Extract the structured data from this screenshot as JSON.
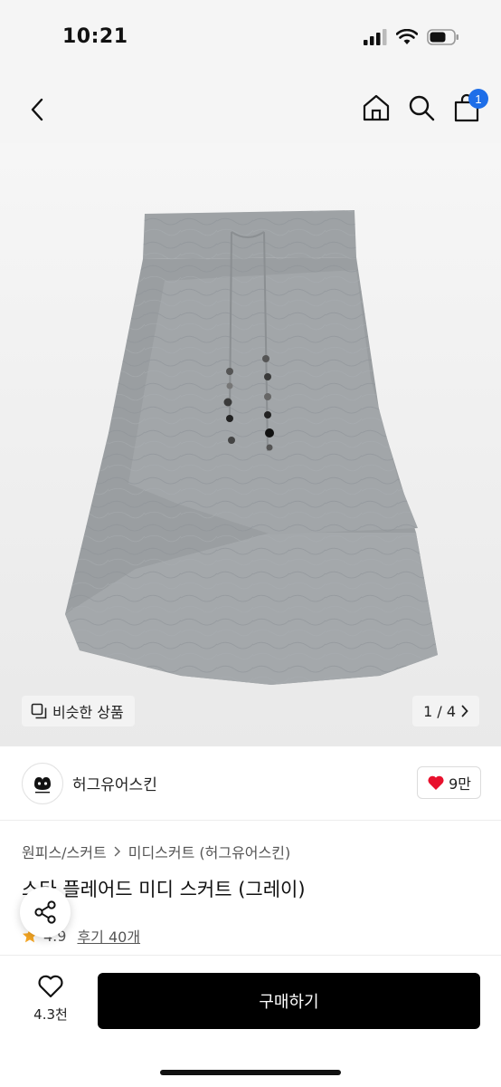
{
  "status": {
    "time": "10:21"
  },
  "nav": {
    "cart_count": "1"
  },
  "gallery": {
    "similar_label": "비슷한 상품",
    "page_indicator": "1 / 4"
  },
  "brand": {
    "name": "허그유어스킨",
    "likes": "9만"
  },
  "breadcrumb": {
    "level1": "원피스/스커트",
    "level2": "미디스커트 (허그유어스킨)"
  },
  "product": {
    "title": "스타 플레어드 미디 스커트 (그레이)",
    "rating": "4.9",
    "reviews": "후기 40개"
  },
  "bottom": {
    "wish_count": "4.3천",
    "buy_label": "구매하기"
  },
  "colors": {
    "accent_blue": "#1e6ee8",
    "heart_red": "#e8112d",
    "star": "#f5a623"
  },
  "icons": [
    "back-icon",
    "home-icon",
    "search-icon",
    "cart-icon",
    "similar-icon",
    "chevron-right-icon",
    "heart-icon",
    "star-icon",
    "share-icon"
  ]
}
